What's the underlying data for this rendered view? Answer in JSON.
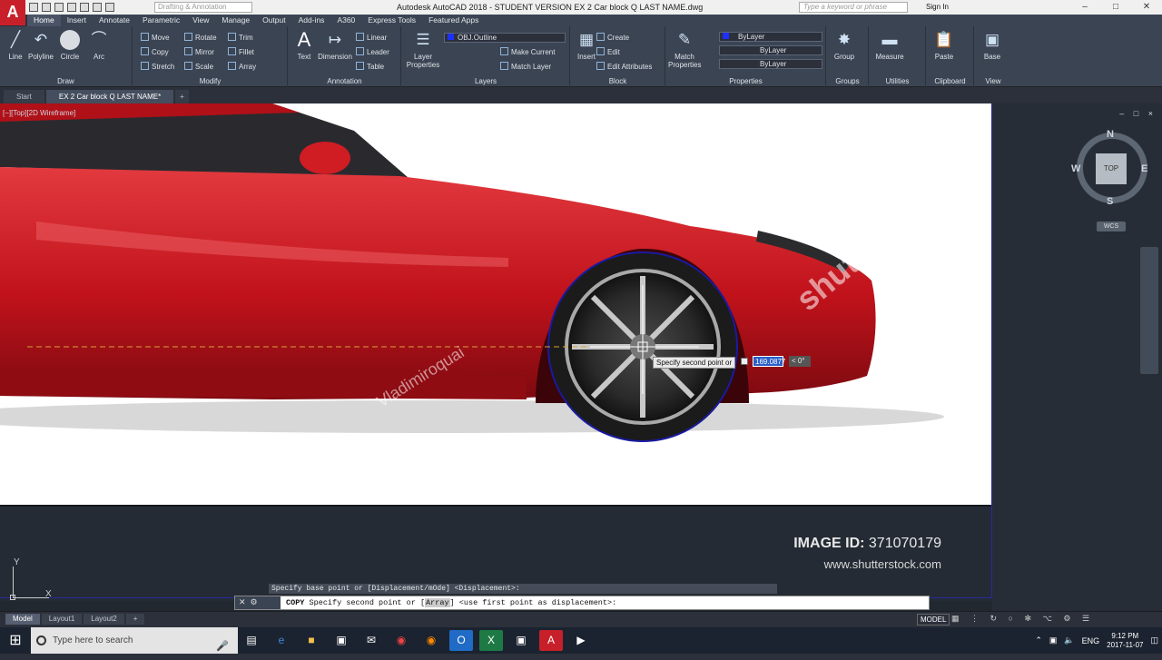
{
  "app": {
    "logo": "A",
    "title": "Autodesk AutoCAD 2018 - STUDENT VERSION    EX 2 Car block Q LAST NAME.dwg",
    "workspace_placeholder": "Drafting & Annotation",
    "search_placeholder": "Type a keyword or phrase",
    "signin": "Sign In"
  },
  "menu_tabs": [
    "Home",
    "Insert",
    "Annotate",
    "Parametric",
    "View",
    "Manage",
    "Output",
    "Add-ins",
    "A360",
    "Express Tools",
    "Featured Apps"
  ],
  "ribbon": {
    "draw": {
      "label": "Draw",
      "tools": [
        "Line",
        "Polyline",
        "Circle",
        "Arc"
      ]
    },
    "modify": {
      "label": "Modify",
      "tools": [
        "Move",
        "Rotate",
        "Trim",
        "Copy",
        "Mirror",
        "Fillet",
        "Stretch",
        "Scale",
        "Array"
      ]
    },
    "annotation": {
      "label": "Annotation",
      "tools": [
        "Text",
        "Dimension"
      ],
      "small": [
        "Linear",
        "Leader",
        "Table"
      ]
    },
    "layers": {
      "label": "Layers",
      "layer_properties": "Layer Properties",
      "current_layer": "OBJ.Outline",
      "make_current": "Make Current",
      "match_layer": "Match Layer"
    },
    "block": {
      "label": "Block",
      "insert": "Insert",
      "create": "Create",
      "edit": "Edit",
      "edit_attributes": "Edit Attributes"
    },
    "properties": {
      "label": "Properties",
      "match": "Match Properties",
      "color": "ByLayer",
      "linetype": "ByLayer",
      "lineweight": "ByLayer"
    },
    "groups": {
      "label": "Groups",
      "group": "Group"
    },
    "utilities": {
      "label": "Utilities",
      "measure": "Measure"
    },
    "clipboard": {
      "label": "Clipboard",
      "paste": "Paste"
    },
    "view": {
      "label": "View",
      "base": "Base"
    }
  },
  "doc_tabs": [
    "Start",
    "EX 2 Car block Q LAST NAME*"
  ],
  "viewport": {
    "label": "[−][Top][2D Wireframe]",
    "ctrl": "– □ ×"
  },
  "image": {
    "id_label": "IMAGE ID:",
    "id_value": "371070179",
    "url": "www.shutterstock.com",
    "watermark_credit": "Vladimiroquai",
    "watermark_brand": "shutterstock"
  },
  "tooltip": {
    "prompt": "Specify second point or",
    "distance": "169.0877",
    "angle": "< 0°"
  },
  "viewcube": {
    "top": "TOP",
    "n": "N",
    "s": "S",
    "e": "E",
    "w": "W",
    "wcs": "WCS"
  },
  "ucs": {
    "x": "X",
    "y": "Y"
  },
  "command": {
    "history": "Specify base point or [Displacement/mOde] <Displacement>:",
    "cmd": "COPY",
    "prompt": "Specify second point or",
    "option": "Array",
    "suffix": "<use first point as displacement>:"
  },
  "layouts": [
    "Model",
    "Layout1",
    "Layout2"
  ],
  "status": {
    "model": "MODEL"
  },
  "taskbar": {
    "search": "Type here to search",
    "lang": "ENG",
    "time": "9:12 PM",
    "date": "2017-11-07"
  },
  "colors": {
    "accent": "#c8202a",
    "ribbon": "#3b4453",
    "canvas": "#212830",
    "car": "#c1121b"
  }
}
